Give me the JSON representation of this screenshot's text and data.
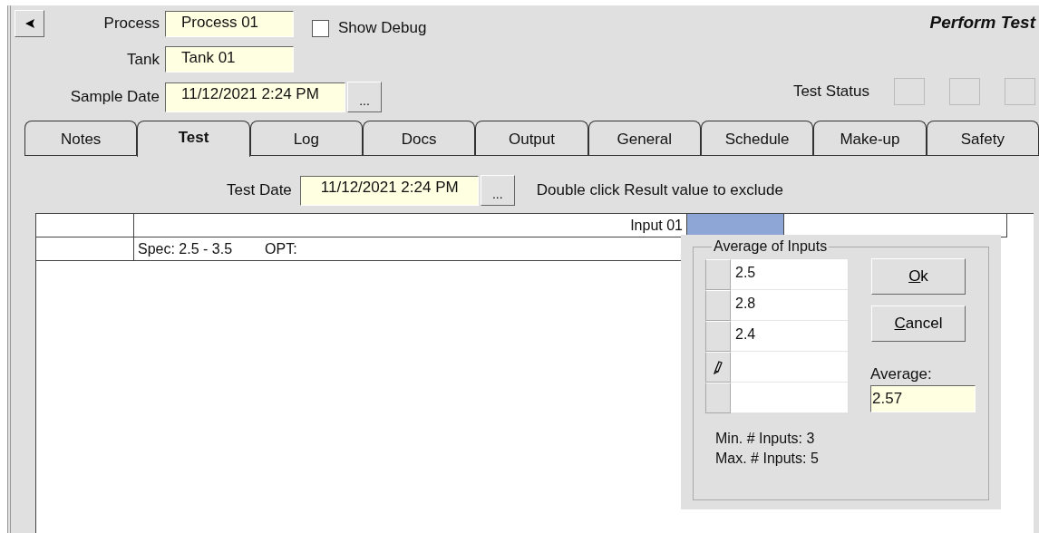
{
  "header": {
    "fields": [
      {
        "label": "Process",
        "value": "Process 01"
      },
      {
        "label": "Tank",
        "value": "Tank 01"
      },
      {
        "label": "Sample Date",
        "value": "11/12/2021 2:24 PM",
        "button": "..."
      }
    ],
    "show_debug": {
      "label": "Show Debug",
      "checked": false
    },
    "page_title": "Perform Test",
    "test_status": {
      "label": "Test Status"
    }
  },
  "tabs": [
    {
      "label": "Notes",
      "selected": false
    },
    {
      "label": "Test",
      "selected": true
    },
    {
      "label": "Log",
      "selected": false
    },
    {
      "label": "Docs",
      "selected": false
    },
    {
      "label": "Output",
      "selected": false
    },
    {
      "label": "General",
      "selected": false
    },
    {
      "label": "Schedule",
      "selected": false
    },
    {
      "label": "Make-up",
      "selected": false
    },
    {
      "label": "Safety",
      "selected": false
    }
  ],
  "test_date": {
    "label": "Test Date",
    "value": "11/12/2021 2:24 PM",
    "button": "...",
    "hint": "Double click Result value to exclude"
  },
  "grid": {
    "header_row": {
      "label": "Input 01",
      "value_selected": true
    },
    "spec_row": {
      "spec": "Spec: 2.5 - 3.5",
      "opt": "OPT:"
    }
  },
  "dialog": {
    "title": "Average of Inputs",
    "inputs": [
      {
        "value": "2.5",
        "editing": false
      },
      {
        "value": "2.8",
        "editing": false
      },
      {
        "value": "2.4",
        "editing": false
      },
      {
        "editing": true
      },
      {
        "editing": false
      }
    ],
    "buttons": [
      {
        "mnemonic": "O",
        "rest": "k"
      },
      {
        "mnemonic": "C",
        "rest": "ancel"
      }
    ],
    "average_label": "Average:",
    "average_value": "2.57",
    "min_inputs": "Min. # Inputs: 3",
    "max_inputs": "Max. # Inputs: 5"
  }
}
